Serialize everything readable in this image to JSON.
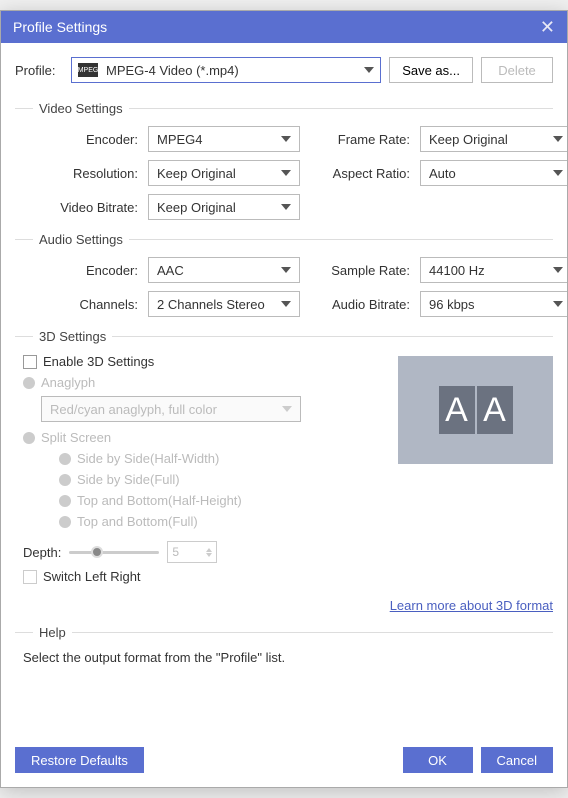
{
  "title": "Profile Settings",
  "profile": {
    "label": "Profile:",
    "icon_text": "MPEG",
    "value": "MPEG-4 Video (*.mp4)",
    "save_as": "Save as...",
    "delete": "Delete"
  },
  "video": {
    "title": "Video Settings",
    "encoder_label": "Encoder:",
    "encoder_value": "MPEG4",
    "framerate_label": "Frame Rate:",
    "framerate_value": "Keep Original",
    "resolution_label": "Resolution:",
    "resolution_value": "Keep Original",
    "aspect_label": "Aspect Ratio:",
    "aspect_value": "Auto",
    "bitrate_label": "Video Bitrate:",
    "bitrate_value": "Keep Original"
  },
  "audio": {
    "title": "Audio Settings",
    "encoder_label": "Encoder:",
    "encoder_value": "AAC",
    "samplerate_label": "Sample Rate:",
    "samplerate_value": "44100 Hz",
    "channels_label": "Channels:",
    "channels_value": "2 Channels Stereo",
    "bitrate_label": "Audio Bitrate:",
    "bitrate_value": "96 kbps"
  },
  "threed": {
    "title": "3D Settings",
    "enable": "Enable 3D Settings",
    "anaglyph": "Anaglyph",
    "anaglyph_value": "Red/cyan anaglyph, full color",
    "split": "Split Screen",
    "opt1": "Side by Side(Half-Width)",
    "opt2": "Side by Side(Full)",
    "opt3": "Top and Bottom(Half-Height)",
    "opt4": "Top and Bottom(Full)",
    "depth_label": "Depth:",
    "depth_value": "5",
    "switch": "Switch Left Right",
    "learn": "Learn more about 3D format"
  },
  "help": {
    "title": "Help",
    "text": "Select the output format from the \"Profile\" list."
  },
  "footer": {
    "restore": "Restore Defaults",
    "ok": "OK",
    "cancel": "Cancel"
  }
}
